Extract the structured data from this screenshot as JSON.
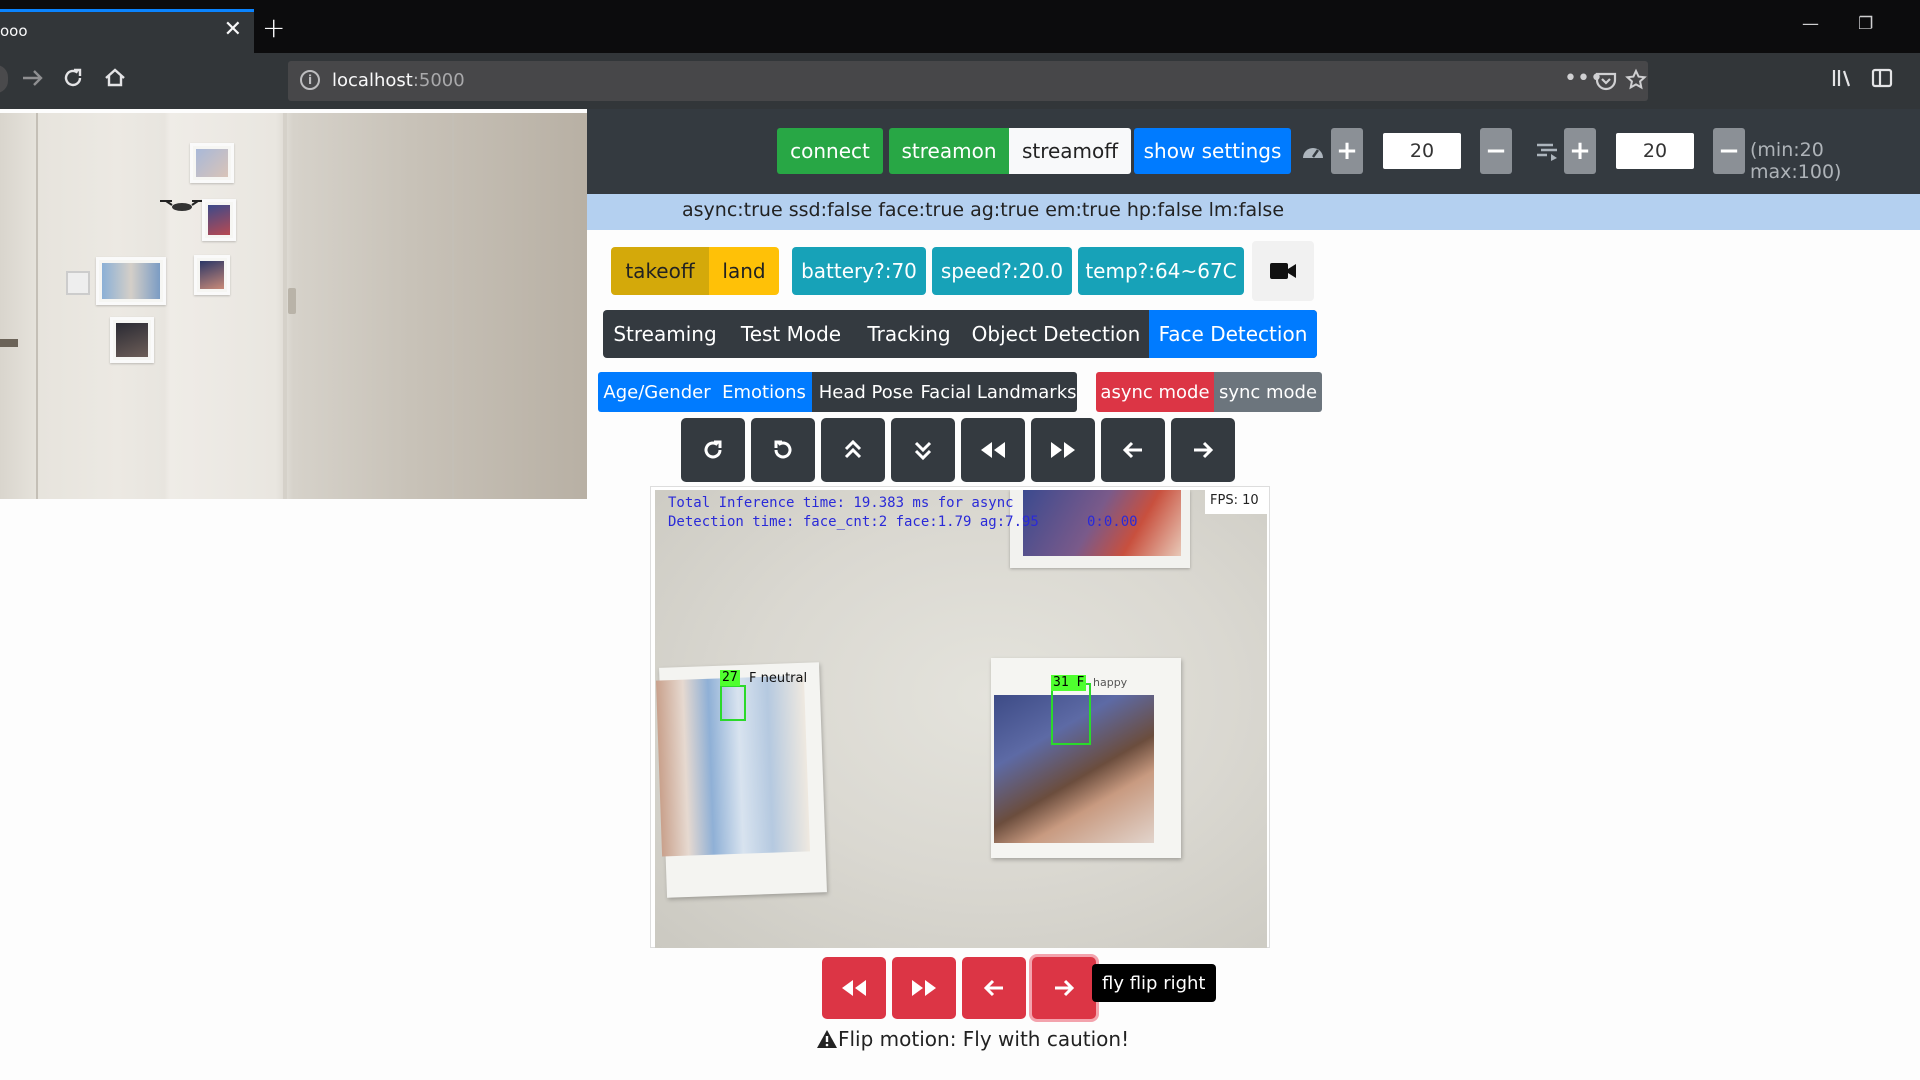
{
  "browser": {
    "tab_title": "ooo",
    "tab_close": "✕",
    "new_tab": "+",
    "url_host": "localhost",
    "url_port": ":5000",
    "window_controls": [
      "—",
      "❐"
    ]
  },
  "controls": {
    "connect": "connect",
    "streamon": "streamon",
    "streamoff": "streamoff",
    "show_settings": "show settings",
    "speed_value": "20",
    "rotation_value": "20",
    "range_note": "(min:20 max:100)"
  },
  "status": "async:true ssd:false face:true ag:true em:true hp:false lm:false",
  "flight": {
    "takeoff": "takeoff",
    "land": "land",
    "battery": "battery?:70",
    "speed": "speed?:20.0",
    "temp": "temp?:64~67C"
  },
  "mode_tabs": [
    "Streaming",
    "Test Mode",
    "Tracking",
    "Object Detection",
    "Face Detection"
  ],
  "active_mode": "Face Detection",
  "detection_tabs": [
    "Age/Gender",
    "Emotions",
    "Head Pose",
    "Facial Landmarks"
  ],
  "sync_tabs": [
    "async mode",
    "sync mode"
  ],
  "direction_buttons": [
    "rotate-cw-icon",
    "rotate-ccw-icon",
    "up-icon",
    "down-icon",
    "backward-icon",
    "forward-icon",
    "left-icon",
    "right-icon"
  ],
  "video": {
    "fps": "FPS: 10",
    "line1": "Total Inference time: 19.383 ms for async",
    "line2": "Detection time: face_cnt:2 face:1.79 ag:7.95",
    "line2_tail": "0:0.00",
    "faces": [
      {
        "label": "27",
        "extra": "F neutral"
      },
      {
        "label": "31 F",
        "extra": "happy"
      }
    ]
  },
  "flip_buttons": [
    "flip-back-icon",
    "flip-forward-icon",
    "flip-left-icon",
    "flip-right-icon"
  ],
  "tooltip": "fly flip right",
  "caution": "Flip motion: Fly with caution!",
  "colors": {
    "green": "#28a745",
    "blue": "#007bff",
    "dark": "#343a40",
    "teal": "#17a2b8",
    "yellow": "#d4a90a",
    "red": "#dc3545",
    "grey": "#6c757d"
  }
}
